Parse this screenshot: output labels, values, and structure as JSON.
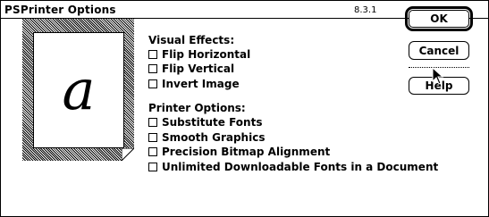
{
  "dialog": {
    "title": "PSPrinter Options",
    "version": "8.3.1"
  },
  "preview": {
    "letter": "a"
  },
  "visual_effects": {
    "heading": "Visual Effects:",
    "options": [
      {
        "label": "Flip Horizontal",
        "checked": false
      },
      {
        "label": "Flip Vertical",
        "checked": false
      },
      {
        "label": "Invert Image",
        "checked": false
      }
    ]
  },
  "printer_options": {
    "heading": "Printer Options:",
    "options": [
      {
        "label": "Substitute Fonts",
        "checked": false
      },
      {
        "label": "Smooth Graphics",
        "checked": false
      },
      {
        "label": "Precision Bitmap Alignment",
        "checked": false
      },
      {
        "label": "Unlimited Downloadable Fonts in a Document",
        "checked": false
      }
    ]
  },
  "buttons": {
    "ok": "OK",
    "cancel": "Cancel",
    "help": "Help"
  },
  "cursor": "arrow-pointer"
}
